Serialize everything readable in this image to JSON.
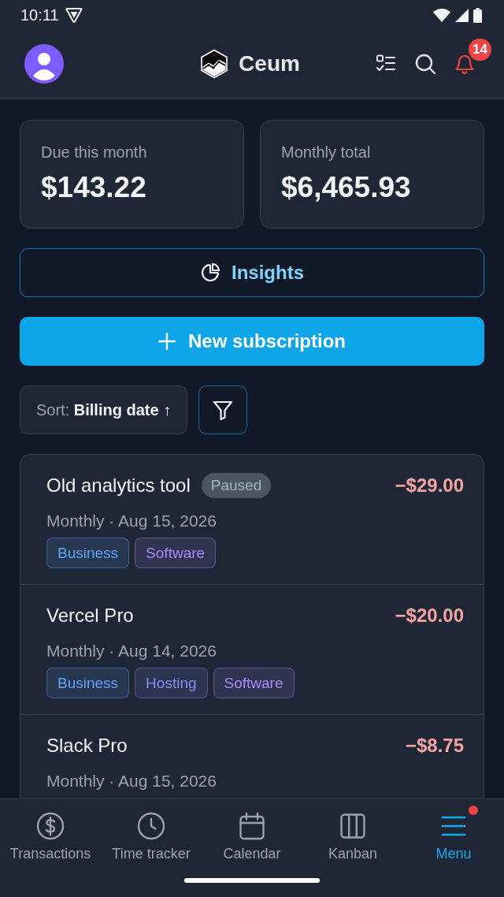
{
  "status_bar": {
    "time": "10:11"
  },
  "header": {
    "app_name": "Ceum",
    "notifications": {
      "count": "14"
    }
  },
  "stats": [
    {
      "label": "Due this month",
      "value": "$143.22"
    },
    {
      "label": "Monthly total",
      "value": "$6,465.93"
    }
  ],
  "insights_button": {
    "label": "Insights"
  },
  "new_subscription_button": {
    "label": "New subscription"
  },
  "sort": {
    "label": "Sort:",
    "value": "Billing date ↑"
  },
  "subscriptions": [
    {
      "name": "Old analytics tool",
      "badge": "Paused",
      "amount": "−$29.00",
      "meta": "Monthly · Aug 15, 2026",
      "tags": [
        {
          "label": "Business",
          "color": "#60a5fa"
        },
        {
          "label": "Software",
          "color": "#a78bfa"
        }
      ]
    },
    {
      "name": "Vercel Pro",
      "amount": "−$20.00",
      "meta": "Monthly · Aug 14, 2026",
      "tags": [
        {
          "label": "Business",
          "color": "#60a5fa"
        },
        {
          "label": "Hosting",
          "color": "#8b8cf8"
        },
        {
          "label": "Software",
          "color": "#a78bfa"
        }
      ]
    },
    {
      "name": "Slack Pro",
      "amount": "−$8.75",
      "meta": "Monthly · Aug 15, 2026"
    }
  ],
  "bottom_nav": [
    {
      "label": "Transactions",
      "selected": false,
      "dot": false
    },
    {
      "label": "Time tracker",
      "selected": false,
      "dot": false
    },
    {
      "label": "Calendar",
      "selected": false,
      "dot": false
    },
    {
      "label": "Kanban",
      "selected": false,
      "dot": false
    },
    {
      "label": "Menu",
      "selected": true,
      "dot": true
    }
  ]
}
